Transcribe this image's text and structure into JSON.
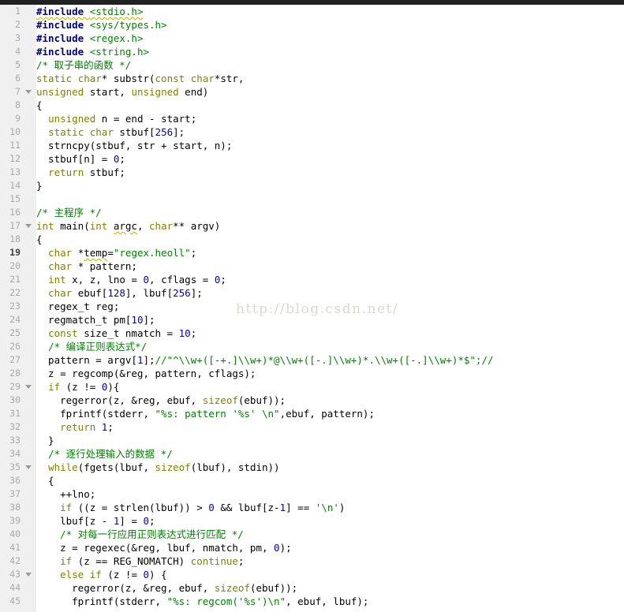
{
  "window": {
    "top_bar_color": "#212121"
  },
  "watermark": {
    "text": "http://blog.csdn.net/"
  },
  "editor": {
    "language": "c",
    "current_line": 19,
    "fold_marker_lines": [
      7,
      17,
      29,
      35,
      43
    ],
    "colors": {
      "background": "#ffffff",
      "gutter_background": "#f0f0f0",
      "line_number": "#a9a9a9",
      "current_line_number": "#3d3d3d",
      "keyword": "#808000",
      "preprocessor": "#000080",
      "string_and_comment": "#008000",
      "number_literal": "#0000c0",
      "plain_text": "#000000",
      "warning_underline": "#b8b000",
      "watermark_text": "#dadad2"
    },
    "lines": [
      {
        "n": 1,
        "seg": [
          [
            "pre u",
            "#include "
          ],
          [
            "inc u",
            "<stdio.h>"
          ]
        ]
      },
      {
        "n": 2,
        "seg": [
          [
            "pre",
            "#include "
          ],
          [
            "inc",
            "<sys/types.h>"
          ]
        ]
      },
      {
        "n": 3,
        "seg": [
          [
            "pre",
            "#include "
          ],
          [
            "inc",
            "<regex.h>"
          ]
        ]
      },
      {
        "n": 4,
        "seg": [
          [
            "pre",
            "#include "
          ],
          [
            "inc",
            "<string.h>"
          ]
        ]
      },
      {
        "n": 5,
        "seg": [
          [
            "com",
            "/* 取子串的函数 */"
          ]
        ]
      },
      {
        "n": 6,
        "seg": [
          [
            "kw",
            "static"
          ],
          [
            "pln",
            " "
          ],
          [
            "kw",
            "char"
          ],
          [
            "pln",
            "* substr("
          ],
          [
            "kw",
            "const"
          ],
          [
            "pln",
            " "
          ],
          [
            "kw",
            "char"
          ],
          [
            "pln",
            "*str,"
          ]
        ]
      },
      {
        "n": 7,
        "fold": true,
        "seg": [
          [
            "kw",
            "unsigned"
          ],
          [
            "pln",
            " start, "
          ],
          [
            "kw",
            "unsigned"
          ],
          [
            "pln",
            " end)"
          ]
        ]
      },
      {
        "n": 8,
        "seg": [
          [
            "pln",
            "{"
          ]
        ]
      },
      {
        "n": 9,
        "seg": [
          [
            "pln",
            "  "
          ],
          [
            "kw",
            "unsigned"
          ],
          [
            "pln",
            " n = end - start;"
          ]
        ]
      },
      {
        "n": 10,
        "seg": [
          [
            "pln",
            "  "
          ],
          [
            "kw",
            "static"
          ],
          [
            "pln",
            " "
          ],
          [
            "kw",
            "char"
          ],
          [
            "pln",
            " stbuf["
          ],
          [
            "num",
            "256"
          ],
          [
            "pln",
            "];"
          ]
        ]
      },
      {
        "n": 11,
        "seg": [
          [
            "pln",
            "  strncpy(stbuf, str + start, n);"
          ]
        ]
      },
      {
        "n": 12,
        "seg": [
          [
            "pln",
            "  stbuf[n] = "
          ],
          [
            "num",
            "0"
          ],
          [
            "pln",
            ";"
          ]
        ]
      },
      {
        "n": 13,
        "seg": [
          [
            "pln",
            "  "
          ],
          [
            "kw",
            "return"
          ],
          [
            "pln",
            " stbuf;"
          ]
        ]
      },
      {
        "n": 14,
        "seg": [
          [
            "pln",
            "}"
          ]
        ]
      },
      {
        "n": 15,
        "seg": []
      },
      {
        "n": 16,
        "seg": [
          [
            "com",
            "/* 主程序 */"
          ]
        ]
      },
      {
        "n": 17,
        "fold": true,
        "seg": [
          [
            "kw",
            "int"
          ],
          [
            "pln",
            " main("
          ],
          [
            "kw",
            "int"
          ],
          [
            "pln",
            " "
          ],
          [
            "pln u",
            "argc"
          ],
          [
            "pln",
            ", "
          ],
          [
            "kw",
            "char"
          ],
          [
            "pln",
            "** argv)"
          ]
        ]
      },
      {
        "n": 18,
        "seg": [
          [
            "pln",
            "{"
          ]
        ]
      },
      {
        "n": 19,
        "cur": true,
        "seg": [
          [
            "pln",
            "  "
          ],
          [
            "kw",
            "char"
          ],
          [
            "pln",
            " *"
          ],
          [
            "pln u",
            "temp"
          ],
          [
            "pln",
            "="
          ],
          [
            "str",
            "\"regex.heoll\""
          ],
          [
            "pln",
            ";"
          ]
        ]
      },
      {
        "n": 20,
        "seg": [
          [
            "pln",
            "  "
          ],
          [
            "kw",
            "char"
          ],
          [
            "pln",
            " * pattern;"
          ]
        ]
      },
      {
        "n": 21,
        "seg": [
          [
            "pln",
            "  "
          ],
          [
            "kw",
            "int"
          ],
          [
            "pln",
            " x, z, lno = "
          ],
          [
            "num",
            "0"
          ],
          [
            "pln",
            ", cflags = "
          ],
          [
            "num",
            "0"
          ],
          [
            "pln",
            ";"
          ]
        ]
      },
      {
        "n": 22,
        "seg": [
          [
            "pln",
            "  "
          ],
          [
            "kw",
            "char"
          ],
          [
            "pln",
            " ebuf["
          ],
          [
            "num",
            "128"
          ],
          [
            "pln",
            "], lbuf["
          ],
          [
            "num",
            "256"
          ],
          [
            "pln",
            "];"
          ]
        ]
      },
      {
        "n": 23,
        "seg": [
          [
            "pln",
            "  regex_t reg;"
          ]
        ]
      },
      {
        "n": 24,
        "seg": [
          [
            "pln",
            "  regmatch_t pm["
          ],
          [
            "num",
            "10"
          ],
          [
            "pln",
            "];"
          ]
        ]
      },
      {
        "n": 25,
        "seg": [
          [
            "pln",
            "  "
          ],
          [
            "kw",
            "const"
          ],
          [
            "pln",
            " size_t nmatch = "
          ],
          [
            "num",
            "10"
          ],
          [
            "pln",
            ";"
          ]
        ]
      },
      {
        "n": 26,
        "seg": [
          [
            "pln",
            "  "
          ],
          [
            "com",
            "/* 编译正则表达式*/"
          ]
        ]
      },
      {
        "n": 27,
        "seg": [
          [
            "pln",
            "  pattern = argv["
          ],
          [
            "num",
            "1"
          ],
          [
            "pln",
            "];"
          ],
          [
            "com",
            "//\"^\\\\w+([-+.]\\\\w+)*@\\\\w+([-.]\\\\w+)*.\\\\w+([-.]\\\\w+)*$\";//"
          ]
        ]
      },
      {
        "n": 28,
        "seg": [
          [
            "pln",
            "  z = regcomp(&reg, pattern, cflags);"
          ]
        ]
      },
      {
        "n": 29,
        "fold": true,
        "seg": [
          [
            "pln",
            "  "
          ],
          [
            "kw",
            "if"
          ],
          [
            "pln",
            " (z != "
          ],
          [
            "num",
            "0"
          ],
          [
            "pln",
            "){"
          ]
        ]
      },
      {
        "n": 30,
        "seg": [
          [
            "pln",
            "    regerror(z, &reg, ebuf, "
          ],
          [
            "kw",
            "sizeof"
          ],
          [
            "pln",
            "(ebuf));"
          ]
        ]
      },
      {
        "n": 31,
        "seg": [
          [
            "pln",
            "    fprintf(stderr, "
          ],
          [
            "str",
            "\"%s: pattern '%s' \\n\""
          ],
          [
            "pln",
            ",ebuf, pattern);"
          ]
        ]
      },
      {
        "n": 32,
        "seg": [
          [
            "pln",
            "    "
          ],
          [
            "kw",
            "return"
          ],
          [
            "pln",
            " "
          ],
          [
            "num",
            "1"
          ],
          [
            "pln",
            ";"
          ]
        ]
      },
      {
        "n": 33,
        "seg": [
          [
            "pln",
            "  }"
          ]
        ]
      },
      {
        "n": 34,
        "seg": [
          [
            "pln",
            "  "
          ],
          [
            "com",
            "/* 逐行处理输入的数据 */"
          ]
        ]
      },
      {
        "n": 35,
        "fold": true,
        "seg": [
          [
            "pln",
            "  "
          ],
          [
            "kw",
            "while"
          ],
          [
            "pln",
            "(fgets(lbuf, "
          ],
          [
            "kw",
            "sizeof"
          ],
          [
            "pln",
            "(lbuf), stdin))"
          ]
        ]
      },
      {
        "n": 36,
        "seg": [
          [
            "pln",
            "  {"
          ]
        ]
      },
      {
        "n": 37,
        "seg": [
          [
            "pln",
            "    ++lno;"
          ]
        ]
      },
      {
        "n": 38,
        "seg": [
          [
            "pln",
            "    "
          ],
          [
            "kw",
            "if"
          ],
          [
            "pln",
            " ((z = strlen(lbuf)) > "
          ],
          [
            "num",
            "0"
          ],
          [
            "pln",
            " && lbuf[z-"
          ],
          [
            "num",
            "1"
          ],
          [
            "pln",
            "] == "
          ],
          [
            "str",
            "'\\n'"
          ],
          [
            "pln",
            ")"
          ]
        ]
      },
      {
        "n": 39,
        "seg": [
          [
            "pln",
            "    lbuf[z - "
          ],
          [
            "num",
            "1"
          ],
          [
            "pln",
            "] = "
          ],
          [
            "num",
            "0"
          ],
          [
            "pln",
            ";"
          ]
        ]
      },
      {
        "n": 40,
        "seg": [
          [
            "pln",
            "    "
          ],
          [
            "com",
            "/* 对每一行应用正则表达式进行匹配 */"
          ]
        ]
      },
      {
        "n": 41,
        "seg": [
          [
            "pln",
            "    z = regexec(&reg, lbuf, nmatch, pm, "
          ],
          [
            "num",
            "0"
          ],
          [
            "pln",
            ");"
          ]
        ]
      },
      {
        "n": 42,
        "seg": [
          [
            "pln",
            "    "
          ],
          [
            "kw",
            "if"
          ],
          [
            "pln",
            " (z == REG_NOMATCH) "
          ],
          [
            "kw",
            "continue"
          ],
          [
            "pln",
            ";"
          ]
        ]
      },
      {
        "n": 43,
        "fold": true,
        "seg": [
          [
            "pln",
            "    "
          ],
          [
            "kw",
            "else"
          ],
          [
            "pln",
            " "
          ],
          [
            "kw",
            "if"
          ],
          [
            "pln",
            " (z != "
          ],
          [
            "num",
            "0"
          ],
          [
            "pln",
            ") {"
          ]
        ]
      },
      {
        "n": 44,
        "seg": [
          [
            "pln",
            "      regerror(z, &reg, ebuf, "
          ],
          [
            "kw",
            "sizeof"
          ],
          [
            "pln",
            "(ebuf));"
          ]
        ]
      },
      {
        "n": 45,
        "seg": [
          [
            "pln",
            "      fprintf(stderr, "
          ],
          [
            "str",
            "\"%s: regcom('%s')\\n\""
          ],
          [
            "pln",
            ", ebuf, lbuf);"
          ]
        ]
      }
    ]
  }
}
